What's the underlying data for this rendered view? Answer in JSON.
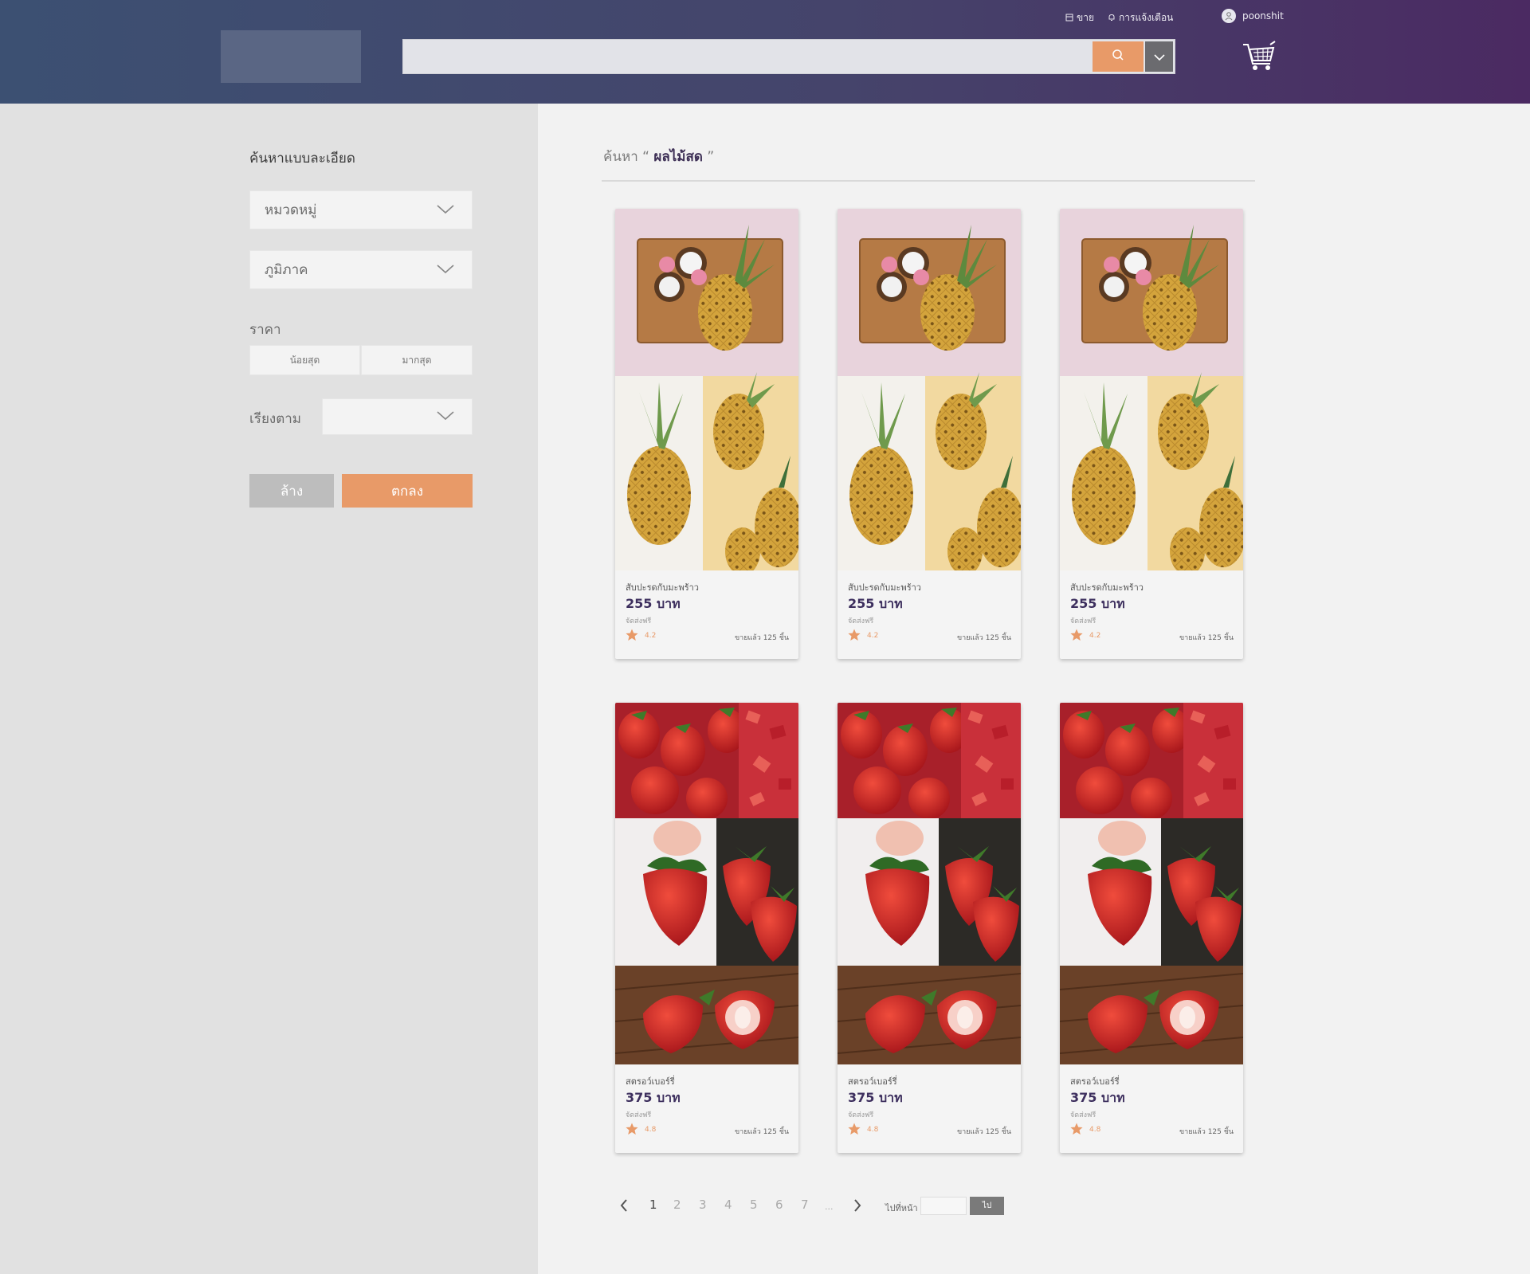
{
  "header": {
    "sell_label": "ขาย",
    "notify_label": "การแจ้งเตือน",
    "username": "poonshit",
    "search_value": ""
  },
  "sidebar": {
    "title": "ค้นหาแบบละเอียด",
    "category_label": "หมวดหมู่",
    "region_label": "ภูมิภาค",
    "price_label": "ราคา",
    "min_placeholder": "น้อยสุด",
    "max_placeholder": "มากสุด",
    "sort_label": "เรียงตาม",
    "sort_value": "",
    "clear_label": "ล้าง",
    "ok_label": "ตกลง"
  },
  "main": {
    "search_prefix": "ค้นหา “",
    "search_term": "ผลไม้สด",
    "search_suffix": "”"
  },
  "products": [
    {
      "name": "สับปะรดกับมะพร้าว",
      "price": "255 บาท",
      "ship": "จัดส่งฟรี",
      "rating": "4.2",
      "sold": "ขายแล้ว 125 ชิ้น"
    },
    {
      "name": "สับปะรดกับมะพร้าว",
      "price": "255 บาท",
      "ship": "จัดส่งฟรี",
      "rating": "4.2",
      "sold": "ขายแล้ว 125 ชิ้น"
    },
    {
      "name": "สับปะรดกับมะพร้าว",
      "price": "255 บาท",
      "ship": "จัดส่งฟรี",
      "rating": "4.2",
      "sold": "ขายแล้ว 125 ชิ้น"
    },
    {
      "name": "สตรอว์เบอร์รี่",
      "price": "375 บาท",
      "ship": "จัดส่งฟรี",
      "rating": "4.8",
      "sold": "ขายแล้ว 125 ชิ้น"
    },
    {
      "name": "สตรอว์เบอร์รี่",
      "price": "375 บาท",
      "ship": "จัดส่งฟรี",
      "rating": "4.8",
      "sold": "ขายแล้ว 125 ชิ้น"
    },
    {
      "name": "สตรอว์เบอร์รี่",
      "price": "375 บาท",
      "ship": "จัดส่งฟรี",
      "rating": "4.8",
      "sold": "ขายแล้ว 125 ชิ้น"
    }
  ],
  "pagination": {
    "pages": [
      "1",
      "2",
      "3",
      "4",
      "5",
      "6",
      "7",
      "..."
    ],
    "goto_label": "ไปที่หน้า",
    "goto_button": "ไป"
  },
  "colors": {
    "accent": "#e89a68",
    "price": "#3d2f5e",
    "header_start": "#3c5072",
    "header_end": "#4b2a62"
  }
}
